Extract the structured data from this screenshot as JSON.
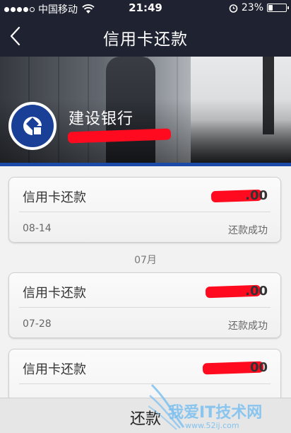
{
  "status_bar": {
    "carrier": "中国移动",
    "time": "21:49",
    "battery": "23%",
    "battery_level": 0.23
  },
  "nav": {
    "title": "信用卡还款"
  },
  "banner": {
    "bank_name": "建设银行"
  },
  "records": [
    {
      "title": "信用卡还款",
      "amount_suffix": ".00",
      "date": "08-14",
      "status": "还款成功"
    },
    {
      "title": "信用卡还款",
      "amount_suffix": ".00",
      "date": "07-28",
      "status": "还款成功"
    },
    {
      "title": "信用卡还款",
      "amount_suffix": "00"
    }
  ],
  "month_label": "07月",
  "bottom": {
    "repay_label": "还款"
  },
  "watermark": {
    "text": "我爱IT技术网",
    "url": "www.52ij.com"
  },
  "colors": {
    "nav_bg": "#1f2230",
    "accent_blue": "#1b4aa8",
    "redaction": "#ff0a1e"
  }
}
